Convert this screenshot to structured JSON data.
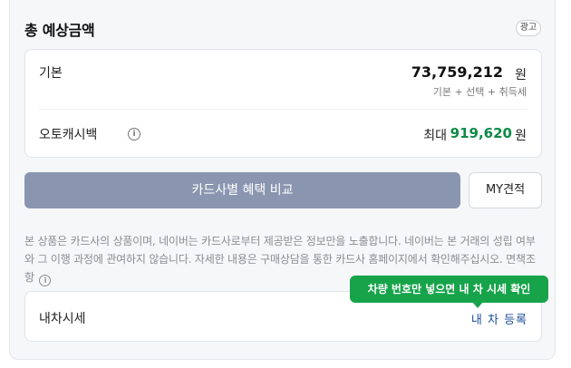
{
  "header": {
    "title": "총 예상금액",
    "ad_badge": "광고"
  },
  "summary": {
    "base_label": "기본",
    "base_amount": "73,759,212",
    "base_unit": "원",
    "base_breakdown": "기본 + 선택 + 취득세",
    "cashback_label": "오토캐시백",
    "cashback_info_icon": "i",
    "cashback_prefix": "최대",
    "cashback_amount": "919,620",
    "cashback_unit": "원"
  },
  "actions": {
    "compare_label": "카드사별 혜택 비교",
    "my_quote_label": "MY견적"
  },
  "disclaimer": {
    "text": "본 상품은 카드사의 상품이며, 네이버는 카드사로부터 제공받은 정보만을 노출합니다. 네이버는 본 거래의 성립 여부와 그 이행 과정에 관여하지 않습니다. 자세한 내용은 구매상담을 통한 카드사 홈페이지에서 확인해주십시오. 면책조항",
    "info_icon": "i"
  },
  "car_price": {
    "label": "내차시세",
    "link_label": "내 차 등록",
    "tooltip": "차량 번호만 넣으면 내 차 시세 확인"
  },
  "colors": {
    "accent_green": "#0e8a47",
    "tooltip_green": "#16a34a",
    "button_slate": "#8a96b0",
    "link_blue": "#1d4f9a"
  }
}
